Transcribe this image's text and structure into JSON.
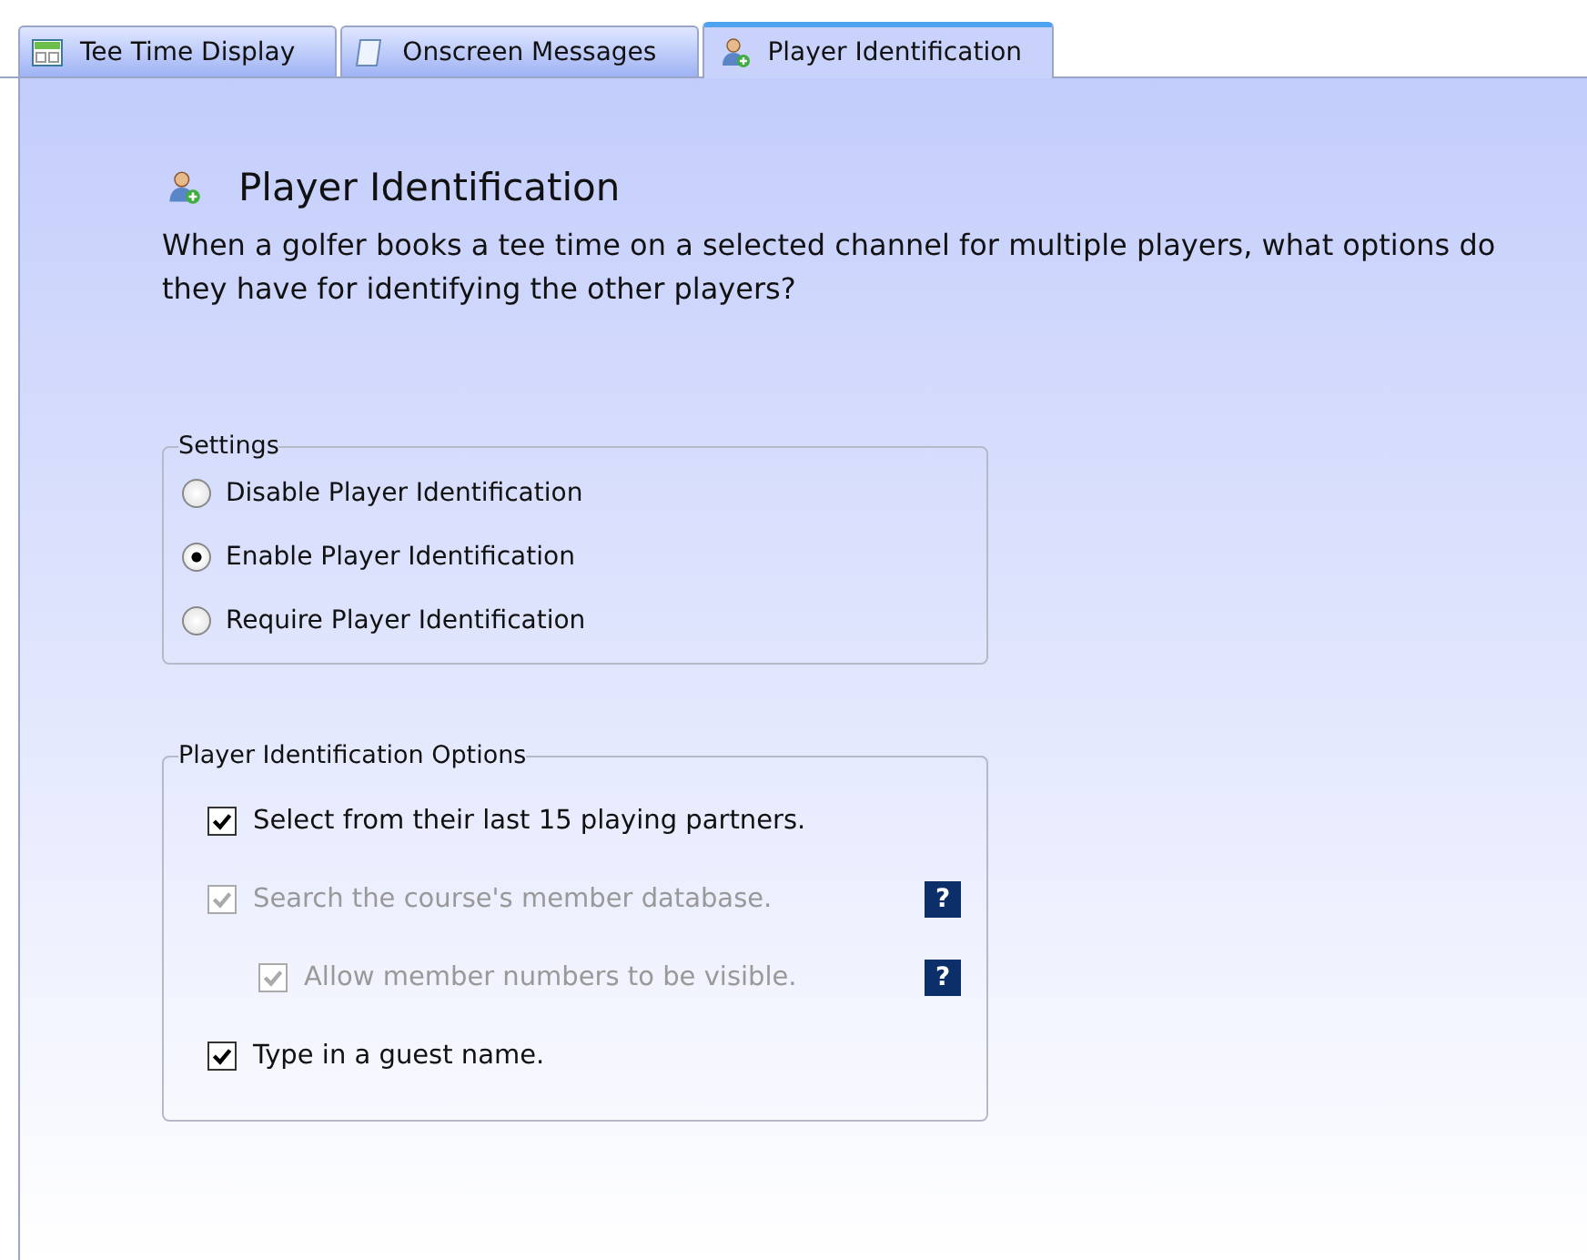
{
  "tabs": [
    {
      "label": "Tee Time Display",
      "selected": false
    },
    {
      "label": "Onscreen Messages",
      "selected": false
    },
    {
      "label": "Player Identification",
      "selected": true
    }
  ],
  "heading": "Player Identification",
  "description": "When a golfer books a tee time on a selected channel for multiple players, what options do they have for identifying the other players?",
  "settings": {
    "title": "Settings",
    "options": [
      {
        "label": "Disable Player Identification",
        "selected": false
      },
      {
        "label": "Enable Player Identification",
        "selected": true
      },
      {
        "label": "Require Player Identification",
        "selected": false
      }
    ]
  },
  "identification_options": {
    "title": "Player Identification Options",
    "options": [
      {
        "label": "Select from their last 15 playing partners.",
        "checked": true,
        "disabled": false
      },
      {
        "label": "Search the course's member database.",
        "checked": true,
        "disabled": true,
        "help": "?",
        "children": [
          {
            "label": "Allow member numbers to be visible.",
            "checked": true,
            "disabled": true,
            "help": "?"
          }
        ]
      },
      {
        "label": "Type in a guest name.",
        "checked": true,
        "disabled": false
      }
    ]
  }
}
